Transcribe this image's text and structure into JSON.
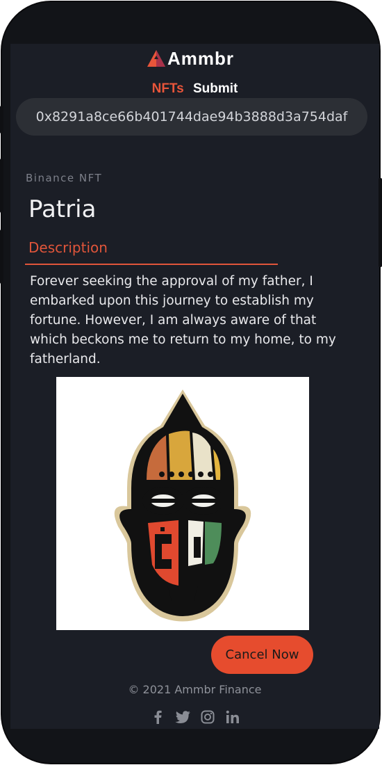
{
  "brand": {
    "name": "Ammbr",
    "accent": "#e8553a"
  },
  "nav": {
    "items": [
      {
        "label": "NFTs",
        "active": true
      },
      {
        "label": "Submit",
        "active": false
      }
    ]
  },
  "wallet": {
    "address": "0x8291a8ce66b401744dae94b3888d3a754daf"
  },
  "nft": {
    "kicker": "Binance NFT",
    "title": "Patria",
    "tab_label": "Description",
    "description": "Forever seeking the approval of my father, I embarked upon this journey to establish my fortune. However, I am always aware of that which beckons me to return to my home, to my fatherland.",
    "image": "african-mask-artwork"
  },
  "actions": {
    "cancel_label": "Cancel Now"
  },
  "footer": {
    "copyright": "© 2021 Ammbr Finance",
    "social": [
      "facebook-icon",
      "twitter-icon",
      "instagram-icon",
      "linkedin-icon"
    ]
  }
}
